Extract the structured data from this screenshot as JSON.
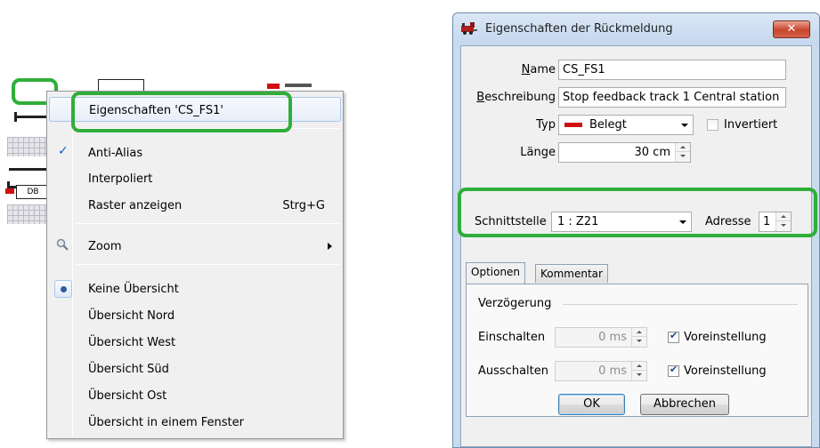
{
  "context_menu": {
    "items": [
      {
        "label": "Eigenschaften 'CS_FS1'"
      },
      {
        "label": "Anti-Alias",
        "checked": true
      },
      {
        "label": "Interpoliert"
      },
      {
        "label": "Raster anzeigen",
        "shortcut": "Strg+G"
      },
      {
        "label": "Zoom",
        "icon": "magnifier-icon",
        "submenu": true
      },
      {
        "label": "Keine Übersicht",
        "selected": true
      },
      {
        "label": "Übersicht Nord"
      },
      {
        "label": "Übersicht West"
      },
      {
        "label": "Übersicht Süd"
      },
      {
        "label": "Übersicht Ost"
      },
      {
        "label": "Übersicht in einem Fenster"
      }
    ]
  },
  "track_diagram": {
    "db_label": "DB"
  },
  "dialog": {
    "title": "Eigenschaften der Rückmeldung",
    "close_label": "✕",
    "name_label_u": "N",
    "name_label_rest": "ame",
    "name_value": "CS_FS1",
    "beschreibung_label_u": "B",
    "beschreibung_label_rest": "eschreibung",
    "beschreibung_value": "Stop feedback track 1 Central station",
    "typ_label": "Typ",
    "typ_value": "Belegt",
    "typ_swatch_color": "#d01010",
    "invertiert_label": "Invertiert",
    "invertiert_checked": false,
    "laenge_label": "Länge",
    "laenge_value": "30 cm",
    "schnittstelle_label": "Schnittstelle",
    "schnittstelle_value": "1 : Z21",
    "adresse_label": "Adresse",
    "adresse_value": "1",
    "tabs": [
      {
        "label": "Optionen",
        "active": true
      },
      {
        "label": "Kommentar",
        "active": false
      }
    ],
    "verzoegerung_label": "Verzögerung",
    "einschalten_label": "Einschalten",
    "einschalten_value": "0 ms",
    "einschalten_voreinstellung_label": "Voreinstellung",
    "ausschalten_label": "Ausschalten",
    "ausschalten_value": "0 ms",
    "ausschalten_voreinstellung_label": "Voreinstellung",
    "ok_label": "OK",
    "abbrechen_label": "Abbrechen"
  },
  "highlight_color": "#2fae3a"
}
